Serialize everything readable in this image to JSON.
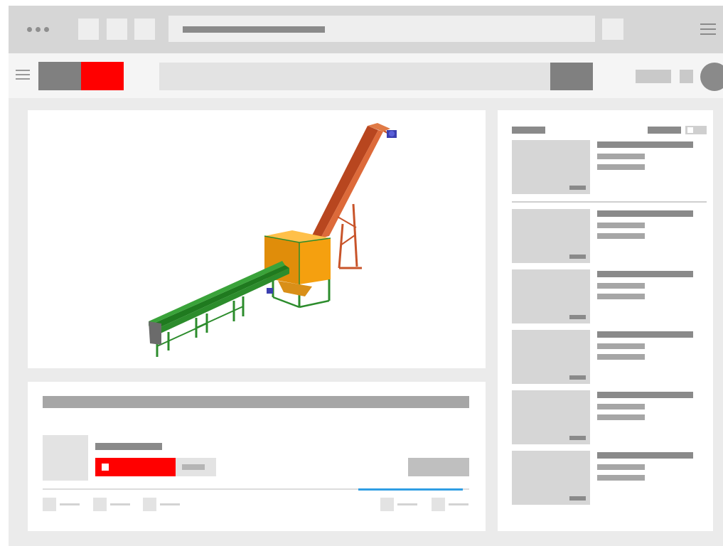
{
  "colors": {
    "brand_red": "#ff0000",
    "accent_blue": "#2f9ee4",
    "chrome_bg": "#d6d6d6",
    "placeholder_dark": "#8a8a8a",
    "placeholder_light": "#e3e3e3"
  },
  "browser": {
    "icons": [
      "window-dots-icon",
      "menu-icon"
    ]
  },
  "header": {
    "icons": [
      "hamburger-icon",
      "logo",
      "search-button",
      "avatar"
    ]
  },
  "player": {
    "content": "conveyor-machine-3d-render",
    "machine_colors": {
      "elevator": "#c8542a",
      "hopper": "#f5a00f",
      "conveyor": "#2c8c2c",
      "motor": "#3b3fb0"
    }
  },
  "sidebar": {
    "up_next_count": 1,
    "recommended_count": 5
  }
}
